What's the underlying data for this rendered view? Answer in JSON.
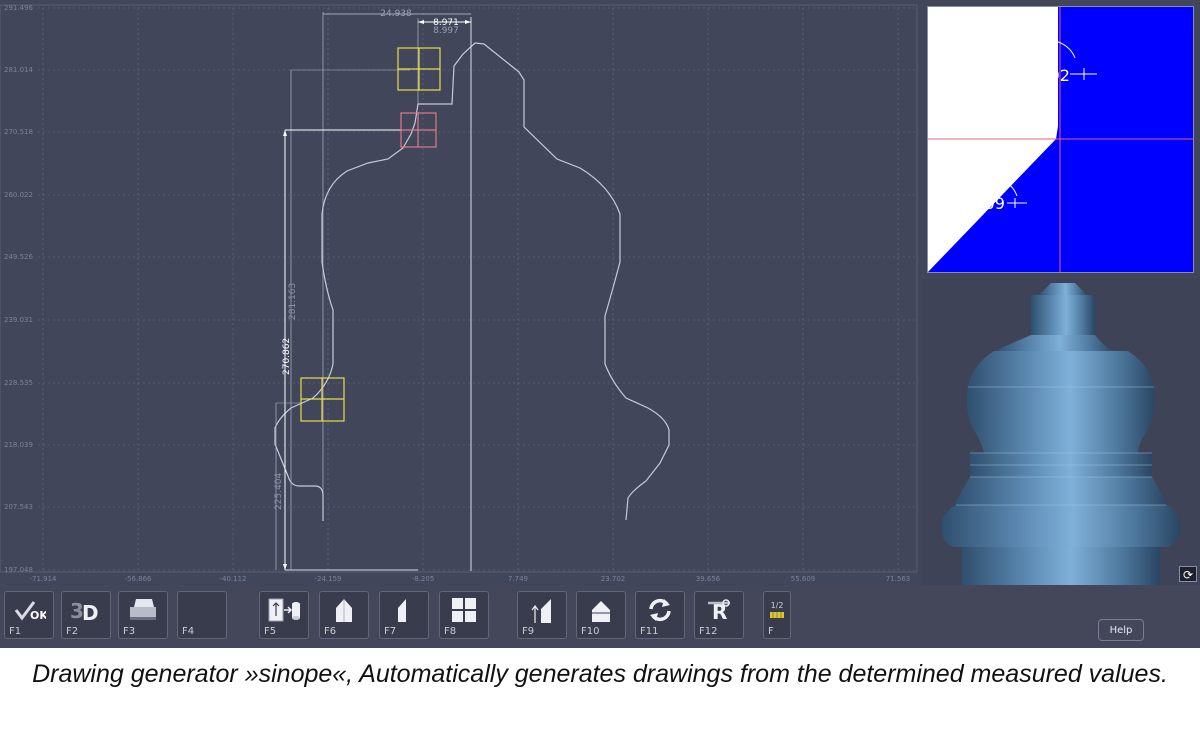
{
  "drawing": {
    "y_axis_labels": [
      "291.496",
      "281.014",
      "270.518",
      "260.022",
      "249.526",
      "239.031",
      "228.535",
      "218.039",
      "207.543",
      "197.048"
    ],
    "x_axis_labels": [
      "-71.914",
      "-56.866",
      "-40.112",
      "-24.159",
      "-8.205",
      "7.749",
      "23.702",
      "39.656",
      "55.609",
      "71.563"
    ],
    "dimensions": {
      "top_width": "24.938",
      "neck_width_outer": "8.971",
      "neck_width_inner": "8.997",
      "total_height": "270.862",
      "shoulder_height": "281.163",
      "lower_height": "225.404"
    },
    "colors": {
      "background": "#41465b",
      "grid": "#6a6e84",
      "contour": "#c4ccd6",
      "dimension_line": "#e6e6ec",
      "marker": "#e6df45",
      "marker_active": "#e07a85"
    }
  },
  "angle_view": {
    "angle_top": "269.92",
    "angle_bottom": "225.09",
    "fill_color": "#0000ff",
    "crosshair_color": "#e0607a"
  },
  "render_view": {
    "part_color": "#6e9bc4",
    "sync_icon": "sync-arrows-icon"
  },
  "toolbar": {
    "buttons": [
      {
        "key": "F1",
        "icon": "ok-check-icon"
      },
      {
        "key": "F2",
        "icon": "3d-view-icon"
      },
      {
        "key": "F3",
        "icon": "printer-icon"
      },
      {
        "key": "F4",
        "icon": "empty-slot"
      },
      {
        "key": "F5",
        "icon": "export-database-icon"
      },
      {
        "key": "F6",
        "icon": "profile-full-icon"
      },
      {
        "key": "F7",
        "icon": "profile-half-icon"
      },
      {
        "key": "F8",
        "icon": "quad-view-icon"
      },
      {
        "key": "F9",
        "icon": "measure-height-icon"
      },
      {
        "key": "F10",
        "icon": "profile-section-icon"
      },
      {
        "key": "F11",
        "icon": "refresh-cycle-icon"
      },
      {
        "key": "F12",
        "icon": "tools-settings-icon"
      },
      {
        "key": "F",
        "icon": "page-toggle-icon"
      }
    ],
    "page_indicator": "1/2",
    "help_label": "Help"
  },
  "caption": "Drawing generator »sinope«, Automatically generates drawings from the determined measured values."
}
